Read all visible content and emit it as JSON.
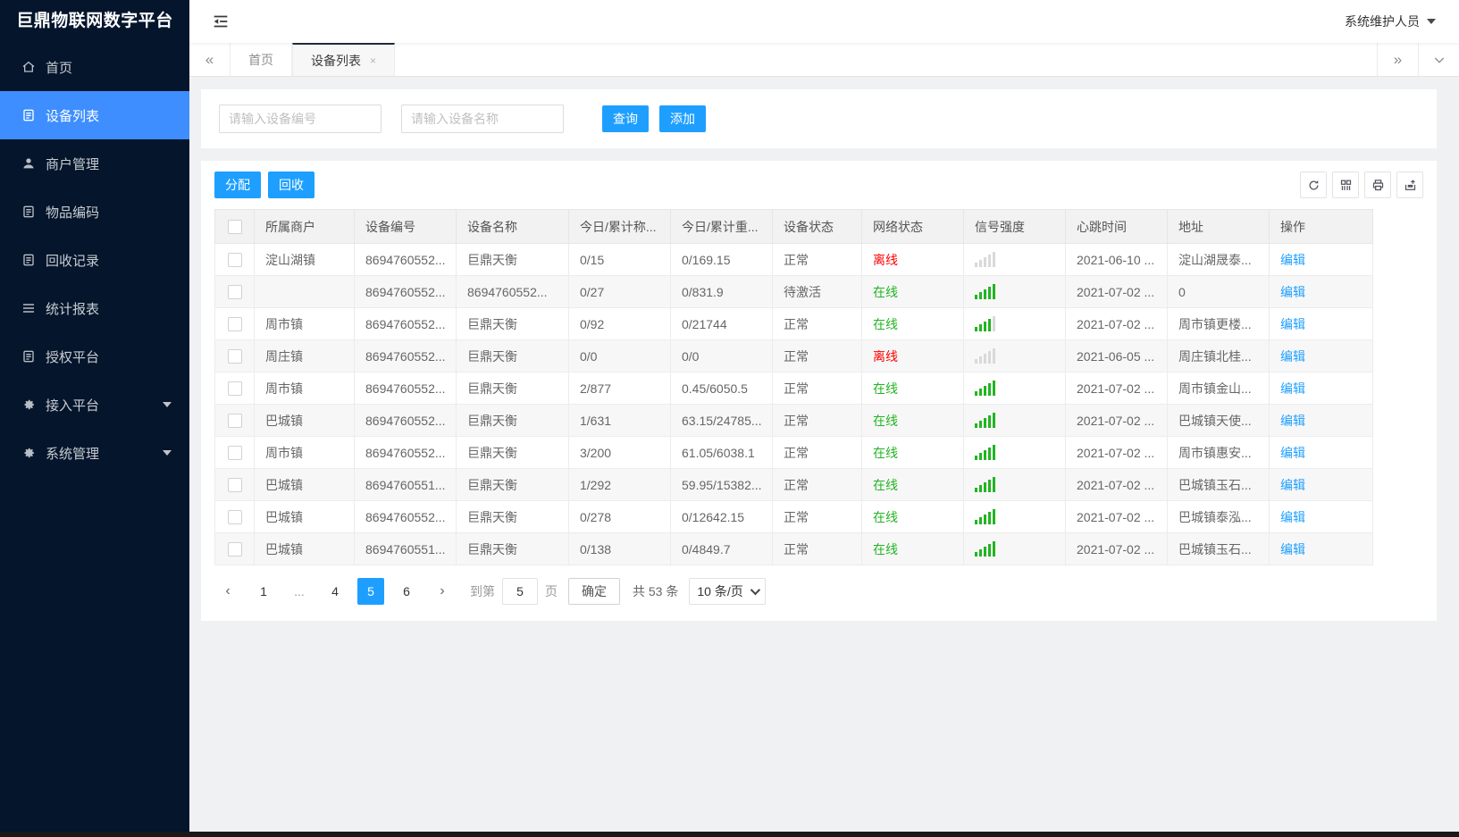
{
  "app": {
    "title": "巨鼎物联网数字平台",
    "user": "系统维护人员"
  },
  "colors": {
    "accent": "#1E9FFF",
    "sidebar_active": "#3E8EFF",
    "online": "#22B422",
    "offline": "#FF0000"
  },
  "sidebar": {
    "items": [
      {
        "icon": "home-icon",
        "label": "首页"
      },
      {
        "icon": "doc-icon",
        "label": "设备列表",
        "active": true
      },
      {
        "icon": "user-icon",
        "label": "商户管理"
      },
      {
        "icon": "doc-icon",
        "label": "物品编码"
      },
      {
        "icon": "doc-icon",
        "label": "回收记录"
      },
      {
        "icon": "menu-icon",
        "label": "统计报表"
      },
      {
        "icon": "doc-icon",
        "label": "授权平台"
      },
      {
        "icon": "gear-icon",
        "label": "接入平台",
        "caret": true
      },
      {
        "icon": "gear-icon",
        "label": "系统管理",
        "caret": true
      }
    ]
  },
  "tabs": {
    "items": [
      {
        "label": "首页"
      },
      {
        "label": "设备列表",
        "active": true,
        "close": "×"
      }
    ]
  },
  "search": {
    "device_no_placeholder": "请输入设备编号",
    "device_name_placeholder": "请输入设备名称",
    "query_label": "查询",
    "add_label": "添加"
  },
  "toolbar": {
    "assign_label": "分配",
    "recycle_label": "回收",
    "icons": [
      "refresh-icon",
      "columns-icon",
      "print-icon",
      "export-icon"
    ]
  },
  "table": {
    "headers": [
      "所属商户",
      "设备编号",
      "设备名称",
      "今日/累计称...",
      "今日/累计重...",
      "设备状态",
      "网络状态",
      "信号强度",
      "心跳时间",
      "地址",
      "操作"
    ],
    "rows": [
      {
        "merchant": "淀山湖镇",
        "device_no": "8694760552...",
        "device_name": "巨鼎天衡",
        "today_count": "0/15",
        "today_weight": "0/169.15",
        "device_status": "正常",
        "net_status": "离线",
        "signal": 0,
        "heartbeat": "2021-06-10 ...",
        "address": "淀山湖晟泰...",
        "action": "编辑"
      },
      {
        "merchant": "",
        "device_no": "8694760552...",
        "device_name": "8694760552...",
        "today_count": "0/27",
        "today_weight": "0/831.9",
        "device_status": "待激活",
        "net_status": "在线",
        "signal": 5,
        "heartbeat": "2021-07-02 ...",
        "address": "0",
        "action": "编辑"
      },
      {
        "merchant": "周市镇",
        "device_no": "8694760552...",
        "device_name": "巨鼎天衡",
        "today_count": "0/92",
        "today_weight": "0/21744",
        "device_status": "正常",
        "net_status": "在线",
        "signal": 4,
        "heartbeat": "2021-07-02 ...",
        "address": "周市镇更楼...",
        "action": "编辑"
      },
      {
        "merchant": "周庄镇",
        "device_no": "8694760552...",
        "device_name": "巨鼎天衡",
        "today_count": "0/0",
        "today_weight": "0/0",
        "device_status": "正常",
        "net_status": "离线",
        "signal": 0,
        "heartbeat": "2021-06-05 ...",
        "address": "周庄镇北桂...",
        "action": "编辑"
      },
      {
        "merchant": "周市镇",
        "device_no": "8694760552...",
        "device_name": "巨鼎天衡",
        "today_count": "2/877",
        "today_weight": "0.45/6050.5",
        "device_status": "正常",
        "net_status": "在线",
        "signal": 5,
        "heartbeat": "2021-07-02 ...",
        "address": "周市镇金山...",
        "action": "编辑"
      },
      {
        "merchant": "巴城镇",
        "device_no": "8694760552...",
        "device_name": "巨鼎天衡",
        "today_count": "1/631",
        "today_weight": "63.15/24785...",
        "device_status": "正常",
        "net_status": "在线",
        "signal": 5,
        "heartbeat": "2021-07-02 ...",
        "address": "巴城镇天使...",
        "action": "编辑"
      },
      {
        "merchant": "周市镇",
        "device_no": "8694760552...",
        "device_name": "巨鼎天衡",
        "today_count": "3/200",
        "today_weight": "61.05/6038.1",
        "device_status": "正常",
        "net_status": "在线",
        "signal": 5,
        "heartbeat": "2021-07-02 ...",
        "address": "周市镇惠安...",
        "action": "编辑"
      },
      {
        "merchant": "巴城镇",
        "device_no": "8694760551...",
        "device_name": "巨鼎天衡",
        "today_count": "1/292",
        "today_weight": "59.95/15382...",
        "device_status": "正常",
        "net_status": "在线",
        "signal": 5,
        "heartbeat": "2021-07-02 ...",
        "address": "巴城镇玉石...",
        "action": "编辑"
      },
      {
        "merchant": "巴城镇",
        "device_no": "8694760552...",
        "device_name": "巨鼎天衡",
        "today_count": "0/278",
        "today_weight": "0/12642.15",
        "device_status": "正常",
        "net_status": "在线",
        "signal": 5,
        "heartbeat": "2021-07-02 ...",
        "address": "巴城镇泰泓...",
        "action": "编辑"
      },
      {
        "merchant": "巴城镇",
        "device_no": "8694760551...",
        "device_name": "巨鼎天衡",
        "today_count": "0/138",
        "today_weight": "0/4849.7",
        "device_status": "正常",
        "net_status": "在线",
        "signal": 5,
        "heartbeat": "2021-07-02 ...",
        "address": "巴城镇玉石...",
        "action": "编辑"
      }
    ]
  },
  "pagination": {
    "prev": "‹",
    "pages": [
      "1",
      "...",
      "4",
      "5",
      "6"
    ],
    "next": "›",
    "goto_label": "到第",
    "goto_value": "5",
    "page_label": "页",
    "confirm_label": "确定",
    "total_label": "共 53 条",
    "page_size": "10 条/页"
  }
}
